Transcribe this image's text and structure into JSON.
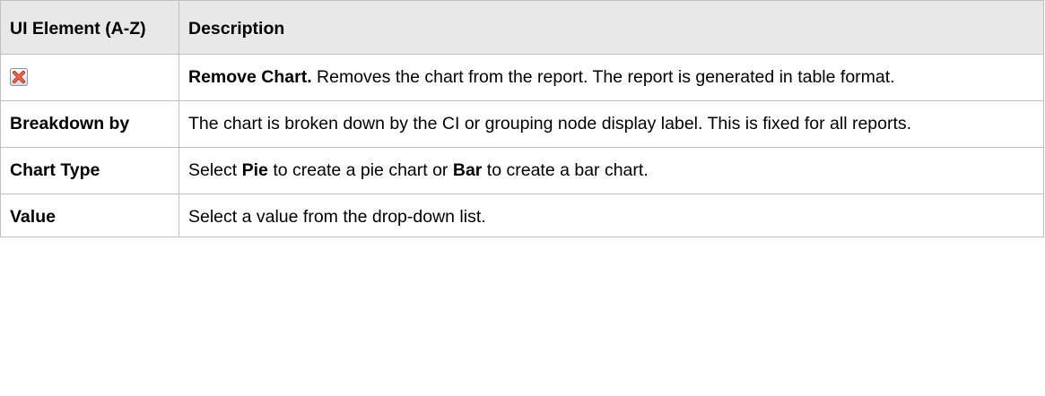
{
  "table": {
    "headers": {
      "element": "UI Element (A-Z)",
      "description": "Description"
    },
    "rows": [
      {
        "element_icon": "remove-chart-icon",
        "desc_bold": "Remove Chart.",
        "desc_text": " Removes the chart from the report. The report is generated in table format."
      },
      {
        "element": "Breakdown by",
        "desc_text": "The chart is broken down by the CI or grouping node display label. This is fixed for all reports."
      },
      {
        "element": "Chart Type",
        "desc_parts": [
          "Select ",
          "Pie",
          " to create a pie chart or ",
          "Bar",
          " to create a bar chart."
        ]
      },
      {
        "element": "Value",
        "desc_text": "Select a value from the drop-down list."
      }
    ]
  },
  "colors": {
    "header_bg": "#e8e8e8",
    "border": "#c0c0c0",
    "icon_red": "#e0452a"
  }
}
